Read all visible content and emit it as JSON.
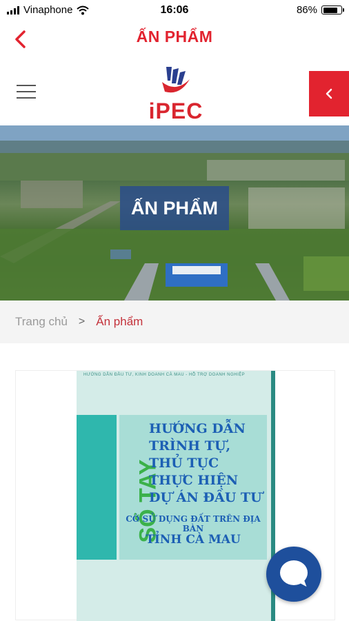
{
  "status_bar": {
    "carrier": "Vinaphone",
    "time": "16:06",
    "battery": "86%",
    "battery_level": 0.86,
    "icons": [
      "signal-icon",
      "wifi-icon",
      "battery-icon"
    ]
  },
  "nav": {
    "title": "ẤN PHẨM",
    "back_icon": "chevron-left-icon"
  },
  "header": {
    "logo_text": "iPEC",
    "menu_icon": "hamburger-icon",
    "side_tab_icon": "chevron-left-icon"
  },
  "hero": {
    "title": "ẤN PHẨM"
  },
  "breadcrumb": {
    "home": "Trang chủ",
    "separator": ">",
    "current": "Ấn phẩm"
  },
  "book": {
    "top_text": "HƯỚNG DẪN ĐẦU TƯ, KINH DOANH CÀ MAU - HỖ TRỢ DOANH NGHIỆP",
    "vertical_title": "SỔ TAY",
    "lines": [
      "HƯỚNG DẪN",
      "TRÌNH TỰ,",
      "THỦ TỤC",
      "THỰC HIỆN",
      "DỰ ÁN ĐẦU TƯ"
    ],
    "subtitle": "CÓ SỬ DỤNG ĐẤT TRÊN ĐỊA BÀN",
    "place": "TỈNH CÀ MAU"
  },
  "colors": {
    "brand_red": "#e2232f",
    "hero_box": "#284b8c",
    "chat_button": "#1e4f9c"
  }
}
